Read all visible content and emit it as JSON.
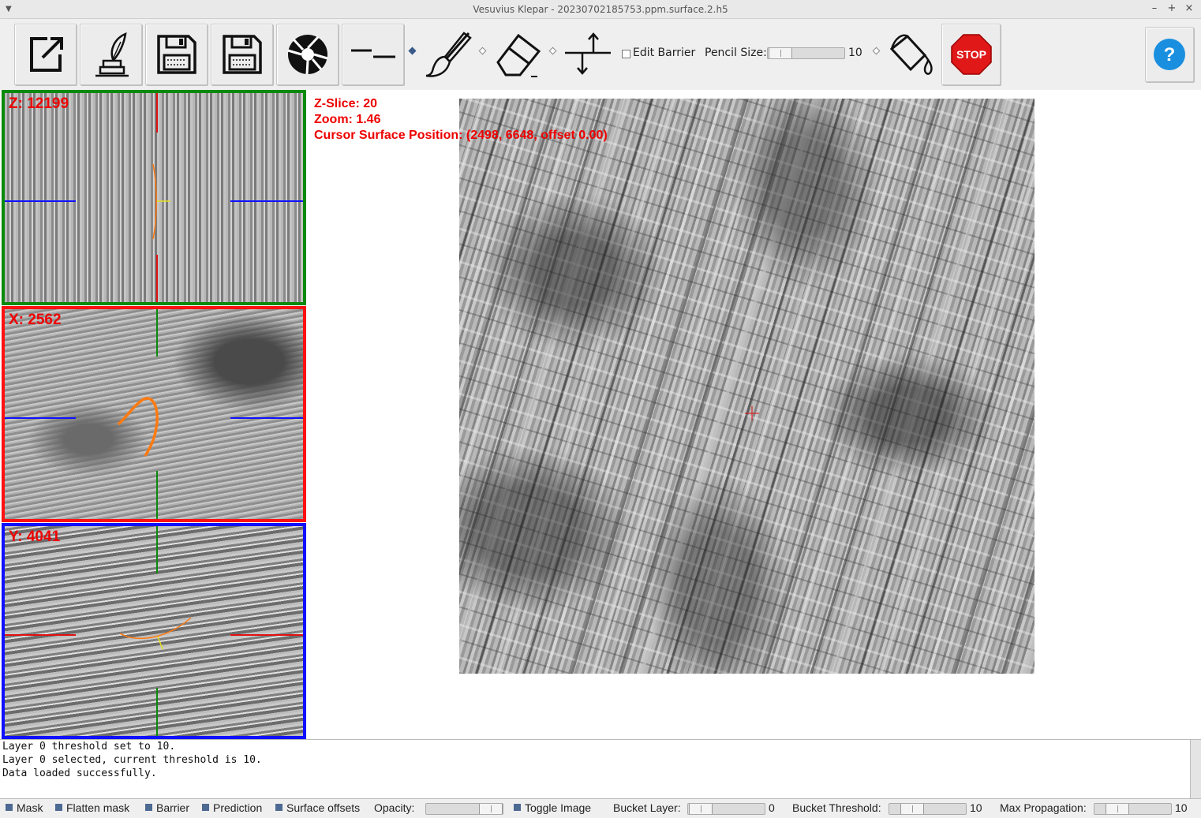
{
  "window": {
    "title": "Vesuvius Klepar - 20230702185753.ppm.surface.2.h5",
    "minimize": "–",
    "maximize": "+",
    "close": "×"
  },
  "toolbar": {
    "edit_barrier_label": "Edit Barrier",
    "edit_barrier_checked": false,
    "pencil_size_label": "Pencil Size:",
    "pencil_size_value": "10",
    "stop_label": "STOP",
    "help_label": "?"
  },
  "panes": {
    "z_label": "Z: 12199",
    "x_label": "X: 2562",
    "y_label": "Y: 4041"
  },
  "info": {
    "zslice": "Z-Slice: 20",
    "zoom": "Zoom: 1.46",
    "cursor": "Cursor Surface Position: (2498, 6648, offset 0.00)"
  },
  "log": {
    "lines": [
      "Layer 0 threshold set to 10.",
      "Layer 0 selected, current threshold is 10.",
      "Data loaded successfully."
    ]
  },
  "bottom": {
    "mask": "Mask",
    "flatten_mask": "Flatten mask",
    "barrier": "Barrier",
    "prediction": "Prediction",
    "surface_offsets": "Surface offsets",
    "opacity": "Opacity:",
    "toggle_image": "Toggle Image",
    "bucket_layer": "Bucket Layer:",
    "bucket_layer_value": "0",
    "bucket_threshold": "Bucket Threshold:",
    "bucket_threshold_value": "10",
    "max_propagation": "Max Propagation:",
    "max_propagation_value": "10"
  },
  "colors": {
    "z_pane": "#0a8a0a",
    "x_pane": "#ff1010",
    "y_pane": "#1010ff",
    "overlay_text": "#ee0000",
    "surface_line": "#ff7a10"
  }
}
